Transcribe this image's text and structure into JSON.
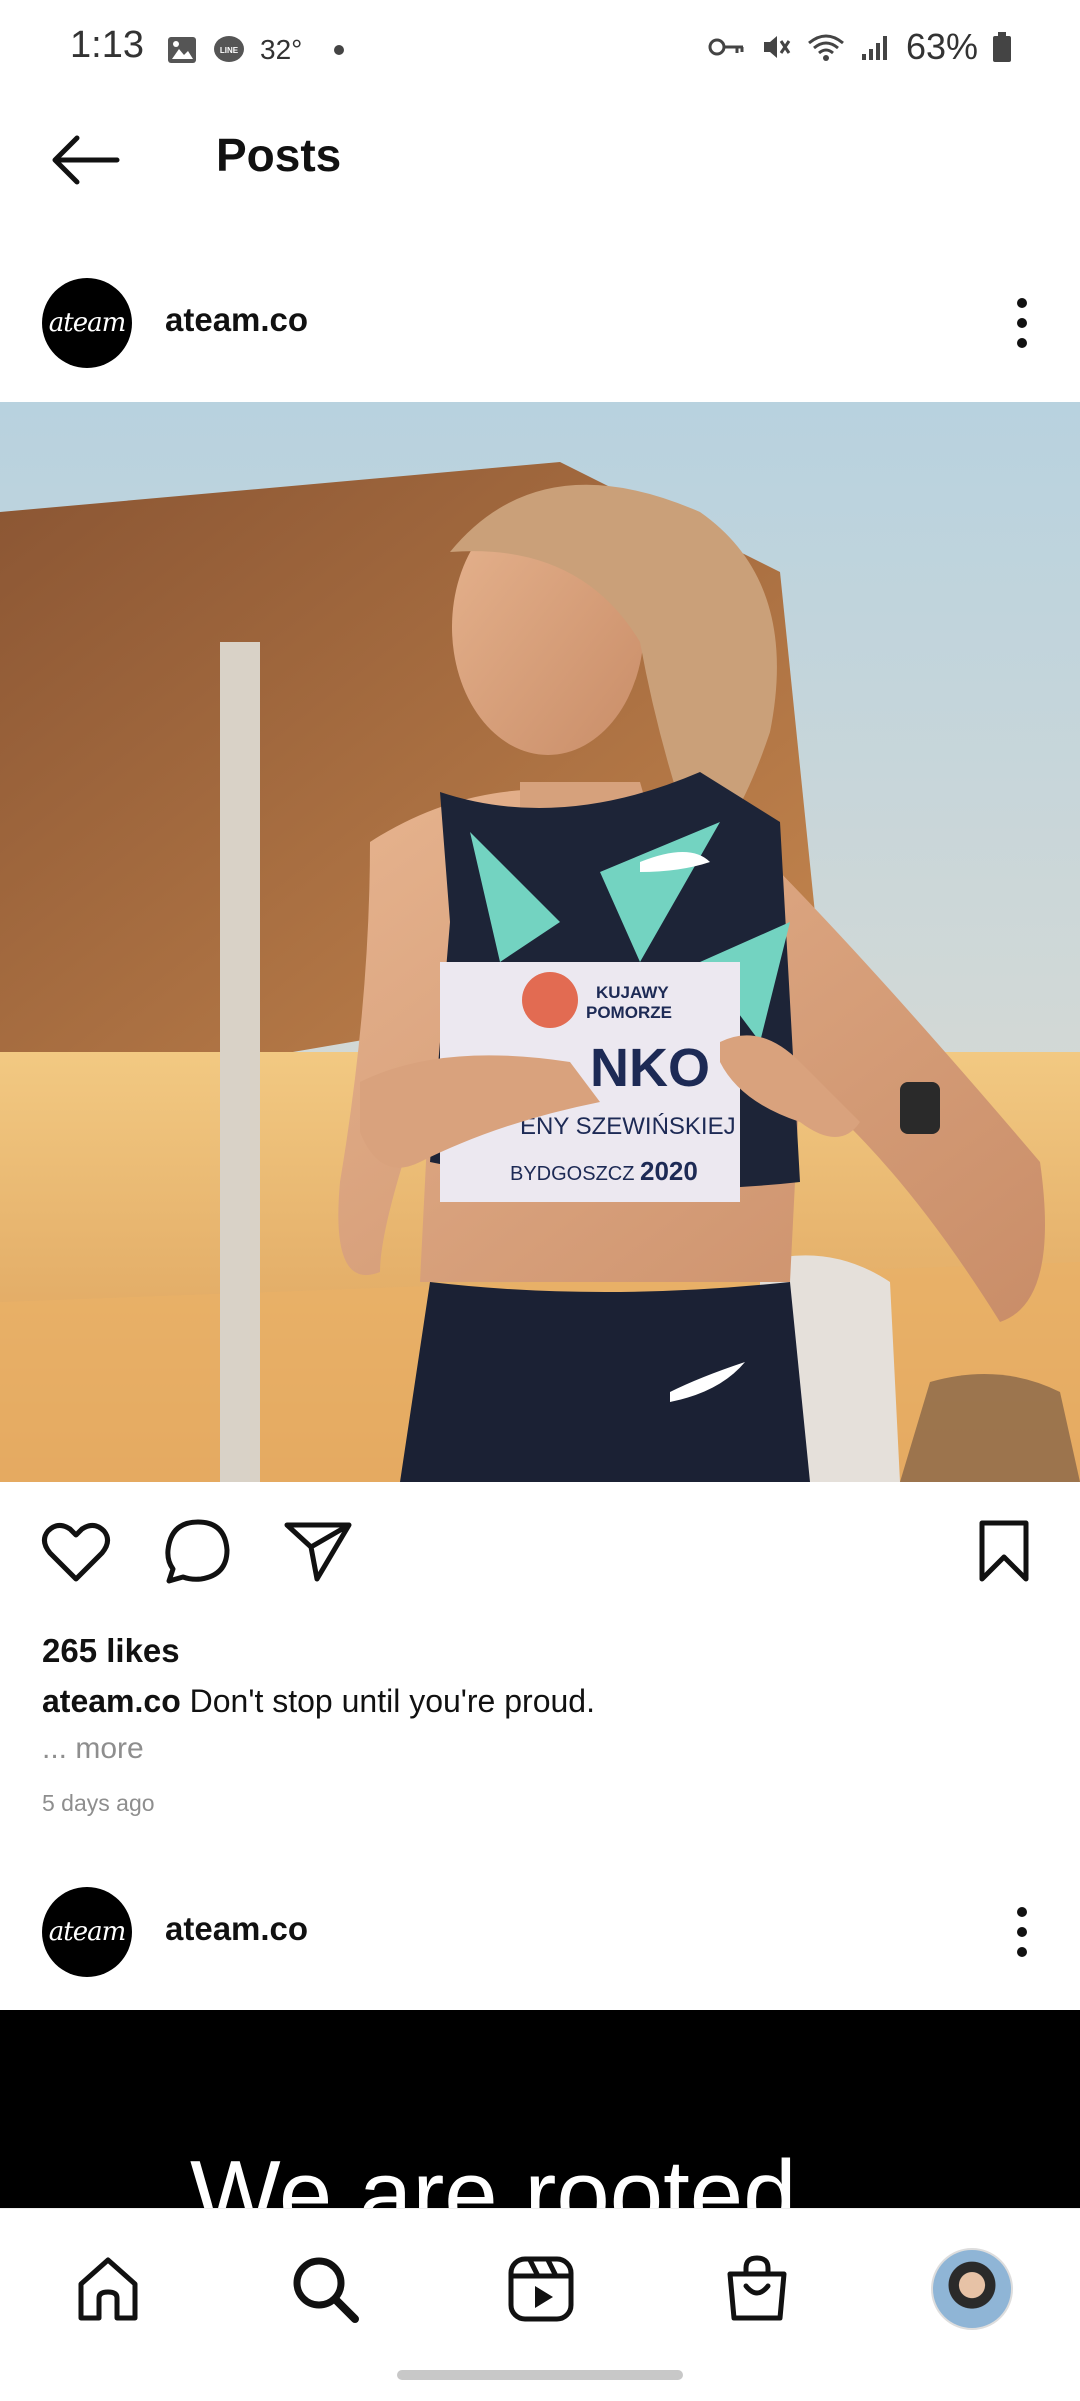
{
  "status_bar": {
    "time": "1:13",
    "temperature": "32°",
    "battery": "63%"
  },
  "header": {
    "title": "Posts"
  },
  "posts": [
    {
      "username": "ateam.co",
      "avatar_text": "ateam",
      "likes": "265 likes",
      "caption_user": "ateam.co",
      "caption_text": "Don't stop until you're proud.",
      "more_label": "... more",
      "time_ago": "5 days ago",
      "image_text": {
        "bib_line1": "KUJAWY",
        "bib_line2": "POMORZE",
        "bib_name": "NKO",
        "bib_line3": "ENY SZEWIŃSKIEJ",
        "bib_city": "BYDGOSZCZ",
        "bib_year": "2020"
      }
    },
    {
      "username": "ateam.co",
      "avatar_text": "ateam",
      "image_text": "We are rooted"
    }
  ],
  "colors": {
    "text": "#111111",
    "secondary": "#8e8e8e",
    "background": "#ffffff"
  }
}
